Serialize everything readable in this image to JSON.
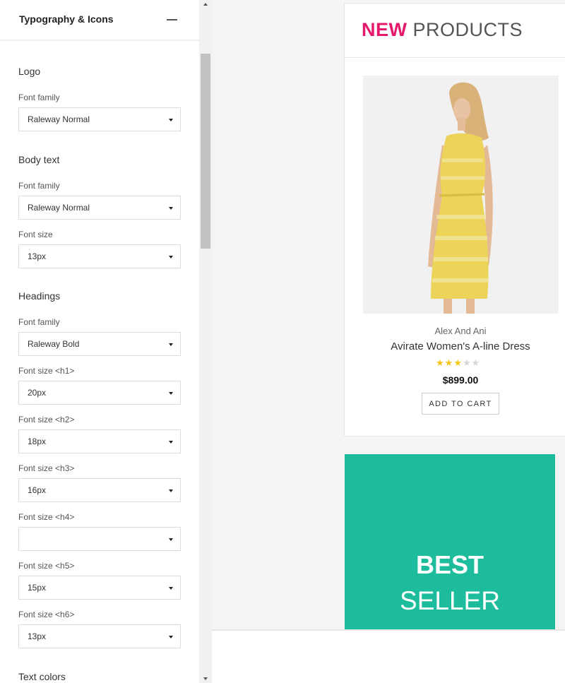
{
  "panel": {
    "title": "Typography & Icons",
    "sections": {
      "logo": {
        "title": "Logo",
        "font_family_label": "Font family",
        "font_family_value": "Raleway Normal"
      },
      "body_text": {
        "title": "Body text",
        "font_family_label": "Font family",
        "font_family_value": "Raleway Normal",
        "font_size_label": "Font size",
        "font_size_value": "13px"
      },
      "headings": {
        "title": "Headings",
        "font_family_label": "Font family",
        "font_family_value": "Raleway Bold",
        "h1_label": "Font size <h1>",
        "h1_value": "20px",
        "h2_label": "Font size <h2>",
        "h2_value": "18px",
        "h3_label": "Font size <h3>",
        "h3_value": "16px",
        "h4_label": "Font size <h4>",
        "h4_value": "",
        "h5_label": "Font size <h5>",
        "h5_value": "15px",
        "h6_label": "Font size <h6>",
        "h6_value": "13px"
      },
      "text_colors": {
        "title": "Text colors"
      }
    }
  },
  "preview": {
    "products_heading": {
      "accent": "NEW",
      "rest": "PRODUCTS",
      "accent_color": "#e5196b"
    },
    "product": {
      "brand": "Alex And Ani",
      "name": "Avirate Women's A-line Dress",
      "rating": 3,
      "rating_max": 5,
      "price": "$899.00",
      "add_to_cart_label": "ADD TO CART"
    },
    "promo": {
      "line1": "BEST",
      "line2": "SELLER",
      "background_color": "#1dbc9c"
    }
  },
  "icons": [
    "minus-icon",
    "chevron-down-icon",
    "star-icon"
  ]
}
